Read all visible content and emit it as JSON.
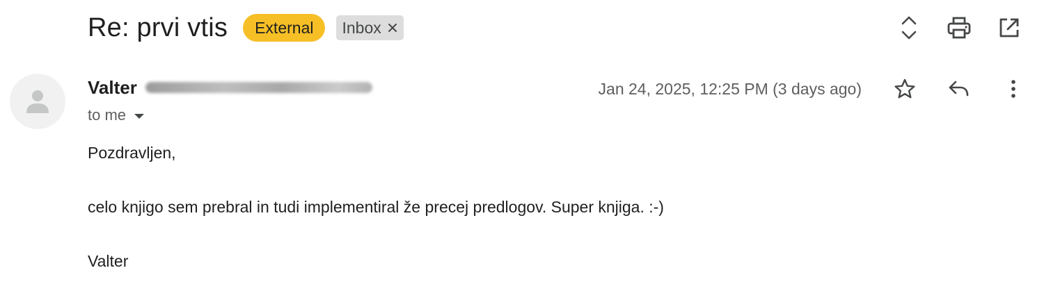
{
  "email": {
    "subject": "Re: prvi vtis",
    "labels": {
      "external": "External",
      "inbox": "Inbox"
    },
    "sender": {
      "name": "Valter"
    },
    "recipient_text": "to me",
    "timestamp": "Jan 24, 2025, 12:25 PM (3 days ago)",
    "body": {
      "greeting": "Pozdravljen,",
      "paragraph": "celo knjigo sem prebral in tudi implementiral že precej predlogov. Super knjiga. :-)",
      "signature": "Valter"
    }
  },
  "icons": {
    "toolbar": [
      "expand-collapse-icon",
      "print-icon",
      "open-in-new-window-icon"
    ],
    "message_actions": [
      "star-icon",
      "reply-icon",
      "more-vert-icon"
    ],
    "label_remove": "close-icon",
    "avatar": "person-icon"
  },
  "colors": {
    "external_label": "#f6bf26",
    "inbox_label": "#dddddd",
    "text_primary": "#1f1f1f",
    "text_secondary": "#5e5e5e",
    "avatar_bg": "#f1f1f1"
  }
}
